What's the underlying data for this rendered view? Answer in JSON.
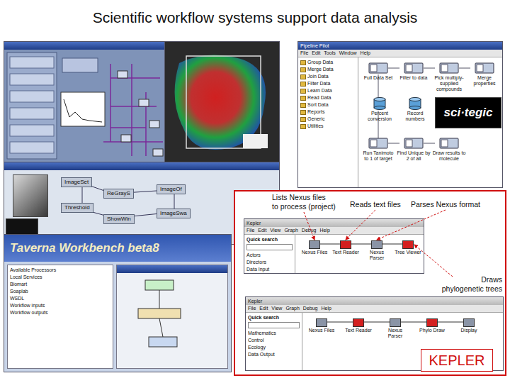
{
  "slide": {
    "title": "Scientific workflow systems support data analysis"
  },
  "image_workflow": {
    "nodes": [
      {
        "label": "ImageSet"
      },
      {
        "label": "ReGrayS"
      },
      {
        "label": "Threshold"
      },
      {
        "label": "ShowWin"
      },
      {
        "label": "ImageOf"
      },
      {
        "label": "ImageSwa"
      }
    ]
  },
  "taverna": {
    "title": "Taverna Workbench beta8",
    "tree": [
      "Available Processors",
      "Local Services",
      "Biomart",
      "Soaplab",
      "WSDL",
      "Workflow inputs",
      "Workflow outputs"
    ]
  },
  "pipeline_pilot": {
    "title": "Pipeline Pilot",
    "menu": [
      "File",
      "Edit",
      "Tools",
      "Window",
      "Help"
    ],
    "tree": [
      "Group Data",
      "Merge Data",
      "Join Data",
      "Filter Data",
      "Learn Data",
      "Read Data",
      "Sort Data",
      "Reports",
      "Generic",
      "Utilities"
    ],
    "nodes": [
      {
        "label": "Full Data Set",
        "kind": "process"
      },
      {
        "label": "Filter to data",
        "kind": "process"
      },
      {
        "label": "Pick multiply-supplied compounds",
        "kind": "process"
      },
      {
        "label": "Merge properties",
        "kind": "process"
      },
      {
        "label": "Percent conversion",
        "kind": "store"
      },
      {
        "label": "Record numbers",
        "kind": "store"
      },
      {
        "label": "Run Tanimoto to 1 of target",
        "kind": "process"
      },
      {
        "label": "Find Unique by 2 of all",
        "kind": "process"
      },
      {
        "label": "Draw results to molecule",
        "kind": "process"
      }
    ],
    "logo": "sci·tegic"
  },
  "kepler": {
    "label": "KEPLER",
    "annotations": [
      {
        "text": "Lists Nexus files\nto process (project)"
      },
      {
        "text": "Reads text files"
      },
      {
        "text": "Parses Nexus format"
      },
      {
        "text": "Draws\nphylogenetic trees"
      }
    ],
    "windows": [
      {
        "title": "Kepler",
        "menu": [
          "File",
          "Edit",
          "View",
          "Graph",
          "Debug",
          "Help"
        ],
        "search": "Quick search",
        "tree": [
          "Actors",
          "Directors",
          "Data Input"
        ],
        "actors": [
          {
            "label": "Nexus Files",
            "color": "#8a94a6"
          },
          {
            "label": "Text Reader",
            "color": "#d42020"
          },
          {
            "label": "Nexus Parser",
            "color": "#8a94a6"
          },
          {
            "label": "Tree Viewer",
            "color": "#d42020"
          }
        ]
      },
      {
        "title": "Kepler",
        "menu": [
          "File",
          "Edit",
          "View",
          "Graph",
          "Debug",
          "Help"
        ],
        "search": "Quick search",
        "tree": [
          "Mathematics",
          "Control",
          "Ecology",
          "Data Output"
        ],
        "actors": [
          {
            "label": "Nexus Files",
            "color": "#8a94a6"
          },
          {
            "label": "Text Reader",
            "color": "#d42020"
          },
          {
            "label": "Nexus Parser",
            "color": "#8a94a6"
          },
          {
            "label": "Phylo Draw",
            "color": "#d42020"
          },
          {
            "label": "Display",
            "color": "#8a94a6"
          }
        ]
      }
    ]
  }
}
